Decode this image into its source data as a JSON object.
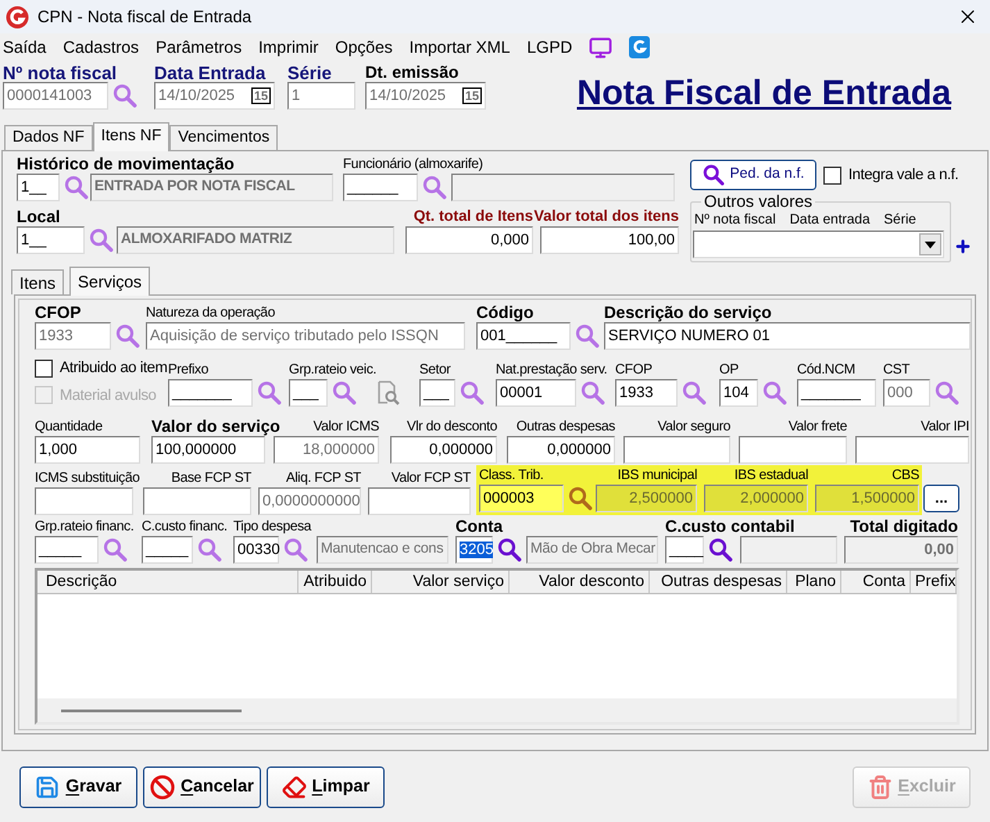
{
  "window": {
    "title": "CPN - Nota fiscal de Entrada"
  },
  "menu": [
    "Saída",
    "Cadastros",
    "Parâmetros",
    "Imprimir",
    "Opções",
    "Importar XML",
    "LGPD"
  ],
  "header": {
    "fields": [
      {
        "label": "Nº nota fiscal",
        "kind": "blue",
        "value": "0000141003",
        "disabled": true,
        "readonly": false,
        "lookup": {
          "color": "#b673e6"
        }
      },
      {
        "label": "Data Entrada",
        "kind": "blue",
        "value": "14/10/2025",
        "disabled": true,
        "readonly": false,
        "calendar": "15"
      },
      {
        "label": "Série",
        "kind": "blue",
        "value": "1",
        "disabled": true,
        "readonly": false
      },
      {
        "label": "Dt. emissão",
        "kind": "bold",
        "value": "14/10/2025",
        "disabled": true,
        "readonly": false,
        "calendar": "15"
      }
    ],
    "heading": "Nota Fiscal de Entrada"
  },
  "tabs": [
    {
      "label": "Dados NF",
      "selected": false
    },
    {
      "label": "Itens NF",
      "selected": true
    },
    {
      "label": "Vencimentos",
      "selected": false
    }
  ],
  "movement": {
    "row_1": [
      {
        "label": "Histórico de movimentação",
        "kind": "bold",
        "value": "1__",
        "disabled": false,
        "readonly": false,
        "lookup": {
          "color": "#b673e6"
        },
        "description": "ENTRADA POR NOTA FISCAL",
        "description_bold": true
      },
      {
        "label": "Funcionário (almoxarife)",
        "kind": "plain",
        "value": "______",
        "disabled": false,
        "readonly": false,
        "lookup": {
          "color": "#b673e6"
        },
        "description_box": true
      }
    ],
    "row_2": [
      {
        "label": "Local",
        "kind": "bold",
        "value": "1__",
        "disabled": false,
        "readonly": false,
        "lookup": {
          "color": "#b673e6"
        },
        "description": "ALMOXARIFADO MATRIZ",
        "description_bold": true
      },
      {
        "label": "Qt. total de Itens",
        "kind": "red",
        "value": "0,000",
        "disabled": false,
        "readonly": false
      },
      {
        "label": "Valor total dos itens",
        "kind": "red",
        "value": "100,00",
        "disabled": false,
        "readonly": false
      }
    ],
    "order_button": "Ped. da n.f.",
    "integra": {
      "label": "Integra vale a n.f.",
      "checked": false,
      "disabled": false
    },
    "outros": {
      "title": "Outros valores",
      "columns": [
        "Nº nota fiscal",
        "Data entrada",
        "Série"
      ]
    }
  },
  "subtabs": [
    {
      "label": "Itens",
      "selected": false
    },
    {
      "label": "Serviços",
      "selected": true
    }
  ],
  "service": {
    "row_a": [
      {
        "label": "CFOP",
        "kind": "bold",
        "value": "1933",
        "disabled": true,
        "readonly": false,
        "lookup": {
          "color": "#b673e6"
        }
      },
      {
        "label": "Natureza da operação",
        "kind": "plain",
        "value": "Aquisição de serviço tributado pelo ISSQN",
        "disabled": true,
        "readonly": false
      },
      {
        "label": "Código",
        "kind": "bold",
        "value": "001______",
        "disabled": false,
        "readonly": false,
        "lookup": {
          "color": "#b673e6"
        }
      },
      {
        "label": "Descrição do serviço",
        "kind": "bold",
        "value": "SERVIÇO NUMERO 01",
        "disabled": false,
        "readonly": false
      }
    ],
    "checks": [
      {
        "label": "Atribuido ao item",
        "checked": false,
        "disabled": false
      },
      {
        "label": "Material avulso",
        "checked": false,
        "disabled": true
      }
    ],
    "row_b": [
      {
        "label": "Prefixo",
        "kind": "plain",
        "value": "_______",
        "disabled": false,
        "readonly": false,
        "lookup": {
          "color": "#b673e6"
        }
      },
      {
        "label": "Grp.rateio veic.",
        "kind": "plain",
        "value": "___",
        "disabled": false,
        "readonly": false,
        "lookup": {
          "color": "#b673e6"
        }
      },
      {
        "label": "Setor",
        "kind": "plain",
        "value": "___",
        "disabled": false,
        "readonly": false,
        "lookup": {
          "color": "#b673e6"
        }
      },
      {
        "label": "Nat.prestação serv.",
        "kind": "plain",
        "value": "00001",
        "disabled": false,
        "readonly": false,
        "lookup": {
          "color": "#b673e6"
        }
      },
      {
        "label": "CFOP",
        "kind": "plain",
        "value": "1933",
        "disabled": false,
        "readonly": false,
        "lookup": {
          "color": "#b673e6"
        }
      },
      {
        "label": "OP",
        "kind": "plain",
        "value": "104",
        "disabled": false,
        "readonly": false,
        "lookup": {
          "color": "#b673e6"
        }
      },
      {
        "label": "Cód.NCM",
        "kind": "plain",
        "value": "_______",
        "disabled": false,
        "readonly": false
      },
      {
        "label": "CST",
        "kind": "plain",
        "value": "000",
        "disabled": true,
        "readonly": false,
        "lookup": {
          "color": "#b673e6"
        }
      }
    ],
    "row_c": [
      {
        "label": "Quantidade",
        "kind": "plain",
        "value": "1,000",
        "disabled": false,
        "readonly": false
      },
      {
        "label": "Valor do serviço",
        "kind": "bold",
        "value": "100,000000",
        "disabled": false,
        "readonly": false
      },
      {
        "label": "Valor ICMS",
        "kind": "plain",
        "value": "18,000000",
        "disabled": true,
        "readonly": false
      },
      {
        "label": "Vlr do desconto",
        "kind": "plain",
        "value": "0,000000",
        "disabled": false,
        "readonly": false
      },
      {
        "label": "Outras despesas",
        "kind": "plain",
        "value": "0,000000",
        "disabled": false,
        "readonly": false
      },
      {
        "label": "Valor seguro",
        "kind": "plain",
        "readonly": false
      },
      {
        "label": "Valor frete",
        "kind": "plain",
        "readonly": false
      },
      {
        "label": "Valor IPI",
        "kind": "plain",
        "readonly": false
      }
    ],
    "row_d": [
      {
        "label": "ICMS substituição",
        "kind": "plain",
        "readonly": false
      },
      {
        "label": "Base FCP ST",
        "kind": "plain",
        "readonly": false
      },
      {
        "label": "Aliq. FCP ST",
        "kind": "plain",
        "value": "0,0000000000",
        "disabled": true,
        "readonly": false
      },
      {
        "label": "Valor FCP ST",
        "kind": "plain",
        "readonly": false
      }
    ],
    "tax": {
      "fields": [
        {
          "label": "Class. Trib.",
          "kind": "plain",
          "value": "000003",
          "disabled": false,
          "readonly": false,
          "lookup": {
            "color": "#b06a1c"
          }
        },
        {
          "label": "IBS municipal",
          "kind": "plain",
          "value": "2,500000",
          "disabled": true,
          "readonly": true
        },
        {
          "label": "IBS estadual",
          "kind": "plain",
          "value": "2,000000",
          "disabled": true,
          "readonly": true
        },
        {
          "label": "CBS",
          "kind": "plain",
          "value": "1,500000",
          "disabled": true,
          "readonly": true
        }
      ],
      "more_button": "..."
    },
    "row_e": [
      {
        "label": "Grp.rateio financ.",
        "kind": "plain",
        "value": "_____",
        "disabled": false,
        "readonly": false,
        "lookup": {
          "color": "#b673e6"
        }
      },
      {
        "label": "C.custo financ.",
        "kind": "plain",
        "value": "_____",
        "disabled": false,
        "readonly": false,
        "lookup": {
          "color": "#b673e6"
        }
      },
      {
        "label": "Tipo despesa",
        "kind": "plain",
        "value": "00330",
        "disabled": false,
        "readonly": false,
        "lookup": {
          "color": "#b673e6"
        },
        "description": "Manutencao e cons",
        "description_bold": false
      },
      {
        "label": "Conta",
        "kind": "bold",
        "value": "3205",
        "disabled": false,
        "readonly": false,
        "lookup": {
          "color": "#6a10d0"
        },
        "text_selected": true,
        "description": "Mão de Obra Mecar",
        "description_bold": false
      },
      {
        "label": "C.custo contabil",
        "kind": "bold",
        "value": "____",
        "disabled": false,
        "readonly": false,
        "lookup": {
          "color": "#6a10d0"
        },
        "description_box": true
      },
      {
        "label": "Total digitado",
        "kind": "bold",
        "value": "0,00",
        "disabled": true,
        "readonly": true,
        "value_bold": true
      }
    ]
  },
  "grid": {
    "columns": [
      "Descrição",
      "Atribuido",
      "Valor serviço",
      "Valor desconto",
      "Outras despesas",
      "Plano",
      "Conta",
      "Prefix"
    ]
  },
  "buttons": [
    {
      "label": "Gravar",
      "kind": "save",
      "disabled": false
    },
    {
      "label": "Cancelar",
      "kind": "cancel",
      "disabled": false
    },
    {
      "label": "Limpar",
      "kind": "clear",
      "disabled": false
    },
    {
      "label": "Excluir",
      "kind": "delete",
      "disabled": true
    }
  ]
}
